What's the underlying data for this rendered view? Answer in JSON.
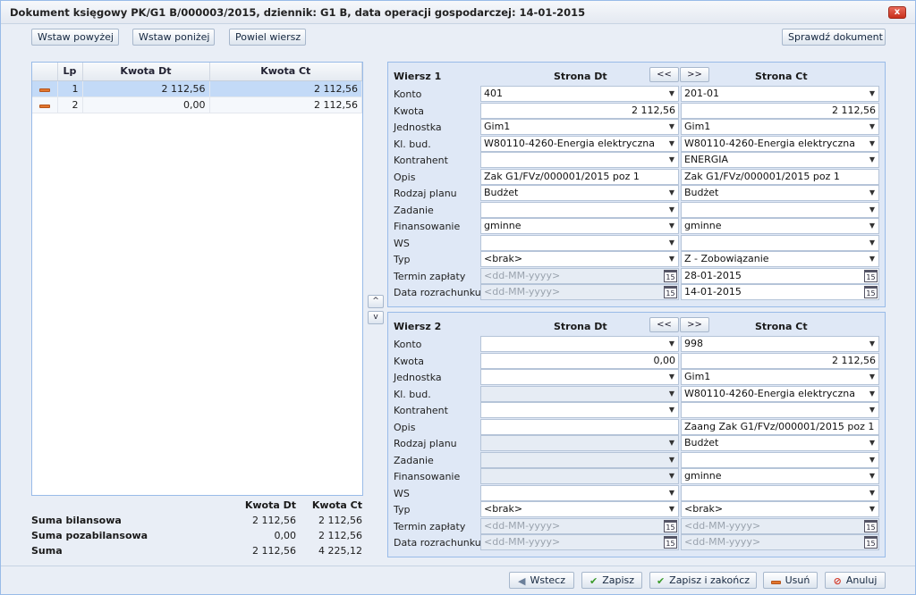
{
  "window": {
    "title": "Dokument księgowy PK/G1 B/000003/2015, dziennik: G1 B, data operacji gospodarczej: 14-01-2015",
    "close_label": "x"
  },
  "toolbar": {
    "insert_above": "Wstaw powyżej",
    "insert_below": "Wstaw poniżej",
    "duplicate_row": "Powiel wiersz",
    "check_document": "Sprawdź dokument"
  },
  "grid": {
    "headers": [
      "",
      "Lp",
      "Kwota Dt",
      "Kwota Ct"
    ],
    "rows": [
      {
        "lp": "1",
        "dt": "2 112,56",
        "ct": "2 112,56"
      },
      {
        "lp": "2",
        "dt": "0,00",
        "ct": "2 112,56"
      }
    ]
  },
  "sums": {
    "hdr_dt": "Kwota Dt",
    "hdr_ct": "Kwota Ct",
    "rows": [
      {
        "label": "Suma bilansowa",
        "dt": "2 112,56",
        "ct": "2 112,56"
      },
      {
        "label": "Suma pozabilansowa",
        "dt": "0,00",
        "ct": "2 112,56"
      },
      {
        "label": "Suma",
        "dt": "2 112,56",
        "ct": "4 225,12"
      }
    ]
  },
  "side_nav": {
    "up": "^",
    "down": "v"
  },
  "panels": [
    {
      "title": "Wiersz 1",
      "dt_label": "Strona Dt",
      "ct_label": "Strona Ct",
      "prev": "<<",
      "next": ">>",
      "fields": [
        {
          "label": "Konto",
          "dt": "401",
          "ct": "201-01",
          "type": "combo"
        },
        {
          "label": "Kwota",
          "dt": "2 112,56",
          "ct": "2 112,56",
          "type": "amount"
        },
        {
          "label": "Jednostka",
          "dt": "Gim1",
          "ct": "Gim1",
          "type": "combo"
        },
        {
          "label": "Kl. bud.",
          "dt": "W80110-4260-Energia elektryczna",
          "ct": "W80110-4260-Energia elektryczna",
          "type": "combo"
        },
        {
          "label": "Kontrahent",
          "dt": "",
          "ct": "ENERGIA",
          "type": "combo"
        },
        {
          "label": "Opis",
          "dt": "Zak G1/FVz/000001/2015 poz 1",
          "ct": "Zak G1/FVz/000001/2015 poz 1",
          "type": "text"
        },
        {
          "label": "Rodzaj planu",
          "dt": "Budżet",
          "ct": "Budżet",
          "type": "combo"
        },
        {
          "label": "Zadanie",
          "dt": "",
          "ct": "",
          "type": "combo"
        },
        {
          "label": "Finansowanie",
          "dt": "gminne",
          "ct": "gminne",
          "type": "combo"
        },
        {
          "label": "WS",
          "dt": "",
          "ct": "",
          "type": "combo"
        },
        {
          "label": "Typ",
          "dt": "<brak>",
          "ct": "Z - Zobowiązanie",
          "type": "combo"
        },
        {
          "label": "Termin zapłaty",
          "dt": "<dd-MM-yyyy>",
          "ct": "28-01-2015",
          "type": "date",
          "dt_disabled": true
        },
        {
          "label": "Data rozrachunku",
          "dt": "<dd-MM-yyyy>",
          "ct": "14-01-2015",
          "type": "date",
          "dt_disabled": true
        }
      ]
    },
    {
      "title": "Wiersz 2",
      "dt_label": "Strona Dt",
      "ct_label": "Strona Ct",
      "prev": "<<",
      "next": ">>",
      "fields": [
        {
          "label": "Konto",
          "dt": "",
          "ct": "998",
          "type": "combo"
        },
        {
          "label": "Kwota",
          "dt": "0,00",
          "ct": "2 112,56",
          "type": "amount"
        },
        {
          "label": "Jednostka",
          "dt": "",
          "ct": "Gim1",
          "type": "combo"
        },
        {
          "label": "Kl. bud.",
          "dt": "",
          "ct": "W80110-4260-Energia elektryczna",
          "type": "combo",
          "dt_disabled": true
        },
        {
          "label": "Kontrahent",
          "dt": "",
          "ct": "",
          "type": "combo"
        },
        {
          "label": "Opis",
          "dt": "",
          "ct": "Zaang Zak G1/FVz/000001/2015 poz 1",
          "type": "text"
        },
        {
          "label": "Rodzaj planu",
          "dt": "",
          "ct": "Budżet",
          "type": "combo",
          "dt_disabled": true
        },
        {
          "label": "Zadanie",
          "dt": "",
          "ct": "",
          "type": "combo",
          "dt_disabled": true
        },
        {
          "label": "Finansowanie",
          "dt": "",
          "ct": "gminne",
          "type": "combo",
          "dt_disabled": true
        },
        {
          "label": "WS",
          "dt": "",
          "ct": "",
          "type": "combo"
        },
        {
          "label": "Typ",
          "dt": "<brak>",
          "ct": "<brak>",
          "type": "combo"
        },
        {
          "label": "Termin zapłaty",
          "dt": "<dd-MM-yyyy>",
          "ct": "<dd-MM-yyyy>",
          "type": "date",
          "dt_disabled": true,
          "ct_disabled": true
        },
        {
          "label": "Data rozrachunku",
          "dt": "<dd-MM-yyyy>",
          "ct": "<dd-MM-yyyy>",
          "type": "date",
          "dt_disabled": true,
          "ct_disabled": true
        }
      ]
    }
  ],
  "footer": {
    "back": "Wstecz",
    "save": "Zapisz",
    "save_close": "Zapisz i zakończ",
    "delete": "Usuń",
    "cancel": "Anuluj"
  },
  "colors": {
    "accent_border": "#99bbe8",
    "selected_row": "#c3daf7",
    "delete_icon": "#e2762e",
    "check_icon": "#3a9a2a",
    "cancel_icon": "#d33a2a"
  },
  "icons": {
    "dropdown": "chevron-down-icon",
    "calendar": "calendar-icon",
    "row_marker": "minus-icon"
  }
}
